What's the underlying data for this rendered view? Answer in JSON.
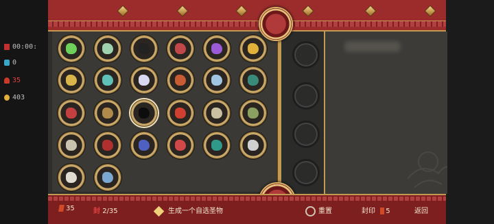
{
  "hud": {
    "timer": "00:00:",
    "stat1": "0",
    "stat2": "35",
    "stat3": "403"
  },
  "colors": {
    "panel_red": "#9c2c2c",
    "gold": "#c49a52",
    "frame_bg": "#2e2d2b"
  },
  "items": [
    {
      "id": "item-green-orb",
      "icon": "green-orb-icon",
      "color": "#6fcf5b"
    },
    {
      "id": "item-jade-talisman",
      "icon": "jade-talisman-icon",
      "color": "#9fd3b0"
    },
    {
      "id": "item-black-bomb",
      "icon": "bomb-icon",
      "color": "#222222"
    },
    {
      "id": "item-red-arrows",
      "icon": "arrows-icon",
      "color": "#c04848"
    },
    {
      "id": "item-purple-crystal",
      "icon": "purple-crystal-icon",
      "color": "#9b5bd6"
    },
    {
      "id": "item-gold-scroll",
      "icon": "gold-scroll-icon",
      "color": "#e0b03a"
    },
    {
      "id": "item-gold-coins",
      "icon": "coins-icon",
      "color": "#d9b44a"
    },
    {
      "id": "item-cyan-bell",
      "icon": "cyan-bell-icon",
      "color": "#5fc0b8"
    },
    {
      "id": "item-white-orb",
      "icon": "white-orb-icon",
      "color": "#d8d8f0"
    },
    {
      "id": "item-red-leaf",
      "icon": "red-leaf-icon",
      "color": "#c85a34"
    },
    {
      "id": "item-blue-claw",
      "icon": "claw-icon",
      "color": "#9fc5e0"
    },
    {
      "id": "item-green-ore",
      "icon": "green-ore-icon",
      "color": "#3a8a7a"
    },
    {
      "id": "item-red-feather",
      "icon": "red-feather-icon",
      "color": "#c24040"
    },
    {
      "id": "item-bronze-pot",
      "icon": "pot-icon",
      "color": "#b08a4a"
    },
    {
      "id": "item-dark-beast",
      "icon": "shadow-beast-icon",
      "color": "#0d0d0d"
    },
    {
      "id": "item-red-heart",
      "icon": "red-heart-icon",
      "color": "#d04030"
    },
    {
      "id": "item-silver-shield",
      "icon": "shield-icon",
      "color": "#c8c0a0"
    },
    {
      "id": "item-green-mask",
      "icon": "mask-icon",
      "color": "#8aa060"
    },
    {
      "id": "item-stone-shell",
      "icon": "shell-icon",
      "color": "#c9c2ae"
    },
    {
      "id": "item-red-claws",
      "icon": "red-claws-icon",
      "color": "#b03030"
    },
    {
      "id": "item-blue-shard",
      "icon": "blue-shard-icon",
      "color": "#5060c0"
    },
    {
      "id": "item-red-wings",
      "icon": "red-wings-icon",
      "color": "#d04848"
    },
    {
      "id": "item-teal-leaf",
      "icon": "teal-leaf-icon",
      "color": "#2f9a8a"
    },
    {
      "id": "item-silver-horn",
      "icon": "horn-icon",
      "color": "#d0d0d0"
    },
    {
      "id": "item-bone-dragon",
      "icon": "bone-dragon-icon",
      "color": "#e0dcd0"
    },
    {
      "id": "item-blue-fang",
      "icon": "fang-icon",
      "color": "#7aa8d0"
    }
  ],
  "bottom": {
    "currency": "35",
    "seal_glyph": "封",
    "seal_count": "2/35",
    "generate_label": "生成一个自选圣物",
    "reset_label": "重置",
    "seal_label": "封印",
    "seal_cost": "5",
    "back_label": "返回"
  }
}
